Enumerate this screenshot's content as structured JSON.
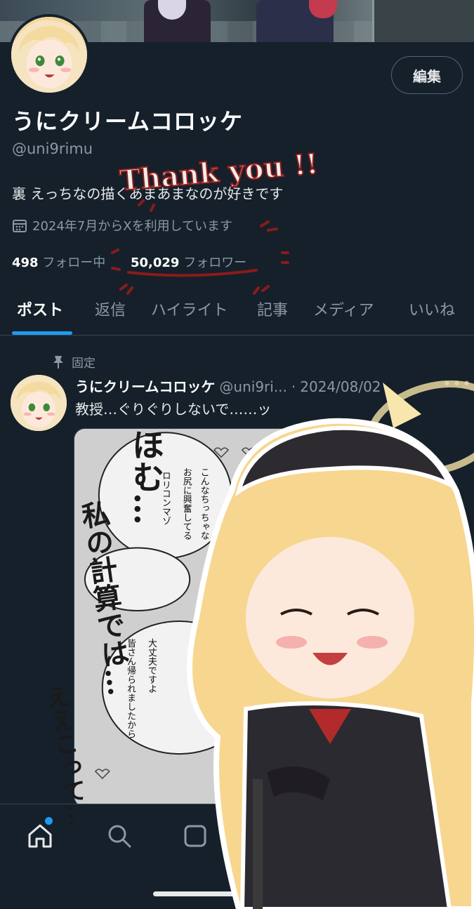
{
  "profile": {
    "edit_label": "編集",
    "display_name": "うにクリームコロッケ",
    "handle": "@uni9rimu",
    "bio": "裏 えっちなの描くあまあまなのが好きです",
    "joined": "2024年7月からXを利用しています",
    "following_count": "498",
    "following_label": "フォロー中",
    "followers_count": "50,029",
    "followers_label": "フォロワー"
  },
  "tabs": [
    {
      "label": "ポスト",
      "active": true
    },
    {
      "label": "返信",
      "active": false
    },
    {
      "label": "ハイライト",
      "active": false
    },
    {
      "label": "記事",
      "active": false
    },
    {
      "label": "メディア",
      "active": false
    },
    {
      "label": "いいね",
      "active": false
    }
  ],
  "post": {
    "pinned_label": "固定",
    "author_name": "うにクリームコロッケ",
    "author_handle": "@uni9ri...",
    "date": "2024/08/02",
    "text": "教授…ぐりぐりしないで……ッ",
    "more_icon": "more-icon",
    "bubble_1": "こんなちっちゃなお尻に興奮してる",
    "bubble_2": "ロリコンマゾ",
    "bubble_3": "大丈夫ですよ",
    "bubble_4": "皆さん帰られましたから"
  },
  "overlay": {
    "thank_you": "Thank you !!",
    "caption_1": "ほむ…",
    "caption_2": "私の計算では…",
    "caption_3": "ええこって…"
  },
  "nav": {
    "icons": [
      "home-icon",
      "search-icon",
      "grok-icon"
    ],
    "accent": "#1d9bf0"
  },
  "colors": {
    "background": "#15202b",
    "secondary_text": "#8b98a5",
    "accent": "#1d9bf0",
    "annotation": "#8a1b1b"
  }
}
